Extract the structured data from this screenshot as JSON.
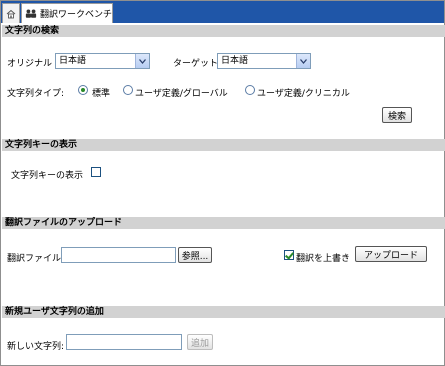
{
  "tabs": {
    "home_icon": "home-icon",
    "main_icon": "users-icon",
    "main_label": "翻訳ワークベンチ"
  },
  "search": {
    "header": "文字列の検索",
    "original_label": "オリジナル",
    "original_value": "日本語",
    "target_label": "ターゲット",
    "target_value": "日本語",
    "type_label": "文字列タイプ:",
    "type_options": [
      "標準",
      "ユーザ定義/グローバル",
      "ユーザ定義/クリニカル"
    ],
    "type_selected": "標準",
    "search_button": "検索"
  },
  "keys": {
    "header": "文字列キーの表示",
    "checkbox_label": "文字列キーの表示",
    "checked": false
  },
  "upload": {
    "header": "翻訳ファイルのアップロード",
    "file_label": "翻訳ファイル",
    "file_value": "",
    "browse_button": "参照...",
    "overwrite_label": "翻訳を上書き",
    "overwrite_checked": true,
    "upload_button": "アップロード"
  },
  "add": {
    "header": "新規ユーザ文字列の追加",
    "new_string_label": "新しい文字列:",
    "new_string_value": "",
    "add_button": "追加",
    "add_button_disabled": true
  },
  "colors": {
    "tabbar": "#1f56a8",
    "section_header": "#d2d2d2",
    "radio_checked": "#2a8a2a"
  }
}
